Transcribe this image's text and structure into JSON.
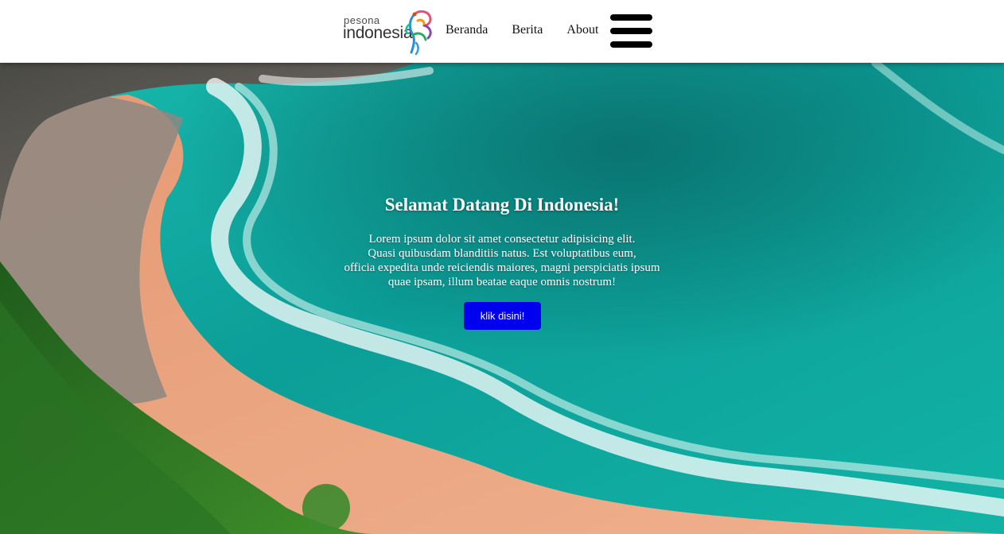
{
  "header": {
    "logo": {
      "small_text": "pesona",
      "big_text": "indonesia",
      "icon": "garuda-bird-logo"
    },
    "nav": [
      {
        "label": "Beranda"
      },
      {
        "label": "Berita"
      },
      {
        "label": "About"
      }
    ],
    "menu_icon": "hamburger-icon"
  },
  "hero": {
    "title": "Selamat Datang Di Indonesia!",
    "description_lines": [
      "Lorem ipsum dolor sit amet consectetur adipisicing elit.",
      "Quasi quibusdam blanditiis natus. Est voluptatibus eum,",
      "officia expedita unde reiciendis maiores, magni perspiciatis ipsum",
      "quae ipsam, illum beatae eaque omnis nostrum!"
    ],
    "button_label": "klik disini!",
    "button_color": "#0000ee",
    "background": "aerial beach photo"
  }
}
